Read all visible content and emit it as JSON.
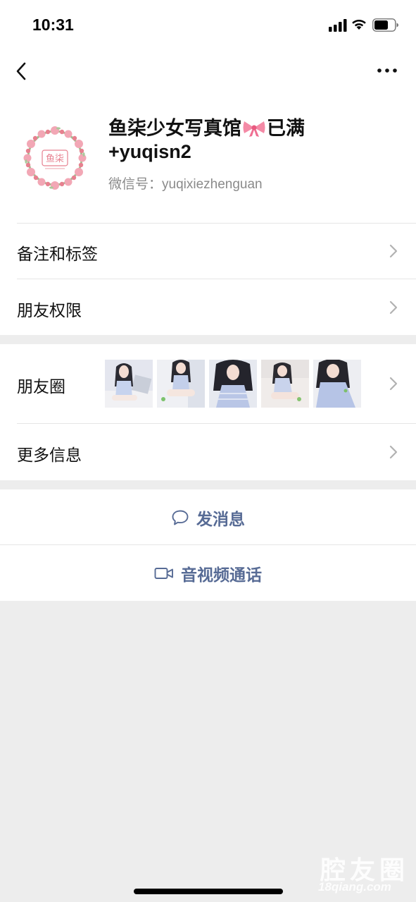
{
  "status_bar": {
    "time": "10:31"
  },
  "profile": {
    "name_part1": "鱼柒少女写真馆",
    "name_part2": "已满",
    "name_line2": "+yuqisn2",
    "wechat_id": "微信号：yuqixiezhenguan",
    "avatar_text": "鱼柒"
  },
  "cells": {
    "remarks_tags": "备注和标签",
    "friend_permissions": "朋友权限",
    "moments": "朋友圈",
    "more_info": "更多信息"
  },
  "actions": {
    "send_message": "发消息",
    "video_call": "音视频通话"
  },
  "watermark": {
    "main": "腔友圈",
    "sub": "18qiang.com"
  },
  "colors": {
    "link_blue": "#576b95",
    "background_gray": "#ededed",
    "secondary_text": "#8a8a8a"
  },
  "icons": {
    "back": "chevron-left-icon",
    "more": "more-dots-icon",
    "message": "chat-bubble-icon",
    "video": "video-camera-icon"
  }
}
